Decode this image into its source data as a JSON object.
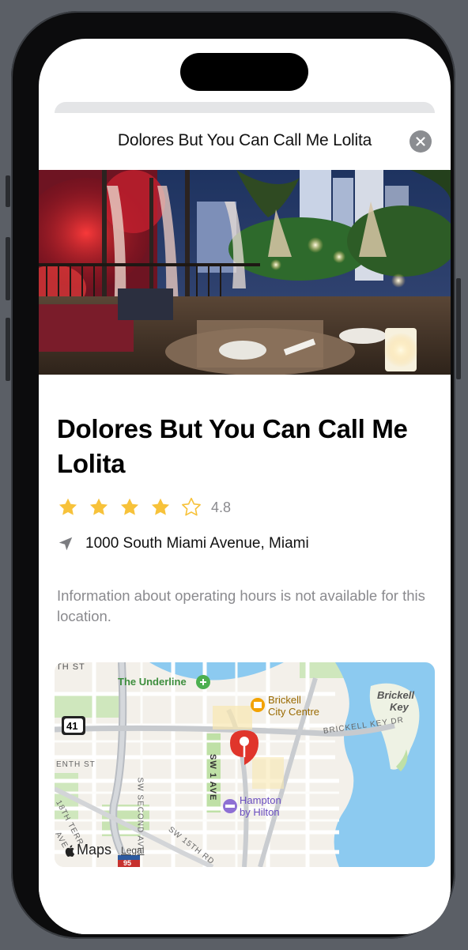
{
  "sheet": {
    "header_title": "Dolores But You Can Call Me Lolita"
  },
  "place": {
    "title": "Dolores But You Can Call Me Lolita",
    "rating_value": "4.8",
    "stars_filled": 4,
    "stars_total": 5,
    "address": "1000 South Miami Avenue, Miami",
    "hours_note": "Information about operating hours is not available for this location."
  },
  "map": {
    "labels": {
      "underline": "The Underline",
      "brickell_city_1": "Brickell",
      "brickell_city_2": "City Centre",
      "brickell_key_1": "Brickell",
      "brickell_key_2": "Key",
      "brickell_key_dr": "BRICKELL KEY DR",
      "route_41": "41",
      "sw_1_ave": "SW 1 AVE",
      "sw_second_ave": "SW SECOND AVE",
      "enth_st": "ENTH ST",
      "th_st": "TH ST",
      "terr": "18TH TERR",
      "sw_15th": "SW 15TH RD",
      "ave": "AVE",
      "hampton_1": "Hampton",
      "hampton_2": "by Hilton",
      "maps_brand": "Maps",
      "legal": "Legal",
      "i95": "95"
    }
  },
  "colors": {
    "star": "#f7c23a",
    "pin": "#e0352b",
    "water": "#7ec3ec",
    "park": "#b9dd9c",
    "hotel": "#8e6fd4"
  },
  "icons": {
    "close": "close-icon",
    "location": "location-arrow-icon",
    "star": "star-icon",
    "pin": "map-pin-icon"
  }
}
